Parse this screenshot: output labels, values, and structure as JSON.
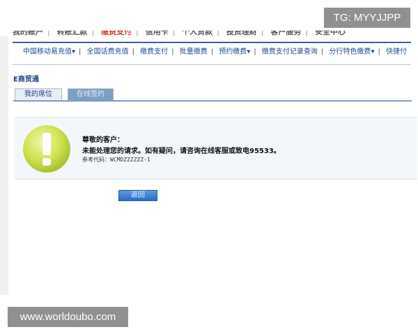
{
  "overlay": {
    "tg_badge": "TG: MYYJJPP",
    "watermark": "www.worldoubo.com"
  },
  "topnav": {
    "items": [
      {
        "label": "我的账户"
      },
      {
        "label": "转账汇款"
      },
      {
        "label": "缴费支付"
      },
      {
        "label": "信用卡"
      },
      {
        "label": "个人贷款"
      },
      {
        "label": "投资理财"
      },
      {
        "label": "客户服务"
      },
      {
        "label": "安全中心"
      }
    ]
  },
  "subnav": {
    "items": [
      {
        "label": "中国移动易充值"
      },
      {
        "label": "全国话费充值"
      },
      {
        "label": "缴费支付"
      },
      {
        "label": "批量缴费"
      },
      {
        "label": "预约缴费"
      },
      {
        "label": "缴费支付记录查询"
      },
      {
        "label": "分行特色缴费"
      },
      {
        "label": "快捷付"
      }
    ]
  },
  "section": {
    "title": "E商贸通"
  },
  "tabs": {
    "mine": "我的席位",
    "online": "在线签约"
  },
  "message": {
    "greeting": "尊敬的客户：",
    "body": "未能处理您的请求。如有疑问，请咨询在线客服或致电95533。",
    "reference": "参考代码：WCMDZZZZZZ-1"
  },
  "buttons": {
    "back": "返回"
  },
  "colors": {
    "accent": "#3a5f9a",
    "warning_icon": "#c6dd4a",
    "button": "#2c6cc4"
  }
}
